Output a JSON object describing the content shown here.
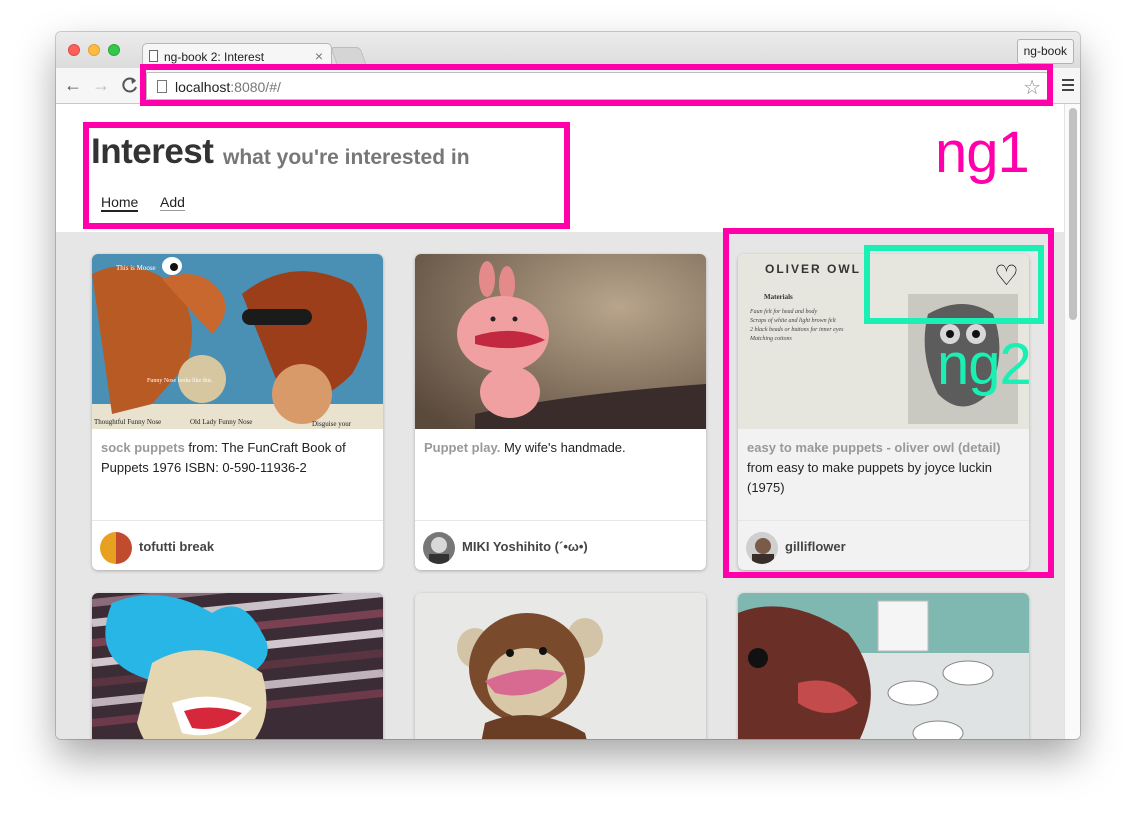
{
  "browser": {
    "tab_title": "ng-book 2: Interest",
    "tab_close": "×",
    "profile_label": "ng-book",
    "url_host": "localhost",
    "url_rest": ":8080/#/",
    "back_glyph": "←",
    "forward_glyph": "→",
    "reload_glyph": "C",
    "star_glyph": "☆"
  },
  "app": {
    "title": "Interest",
    "subtitle": "what you're interested in",
    "nav": [
      {
        "label": "Home"
      },
      {
        "label": "Add"
      }
    ]
  },
  "cards": [
    {
      "caption_title": "sock puppets",
      "caption_text": " from: The FunCraft Book of Puppets 1976 ISBN: 0-590-11936-2",
      "author": "tofutti break"
    },
    {
      "caption_title": "Puppet play.",
      "caption_text": " My wife's handmade.",
      "author": "MIKI Yoshihito (´•ω•)"
    },
    {
      "caption_title": "easy to make puppets - oliver owl (detail)",
      "caption_text": " from easy to make puppets by joyce luckin (1975)",
      "author": "gilliflower",
      "image_heading": "OLIVER OWL",
      "image_subheading": "Materials",
      "image_text": [
        "Faun felt for head and body",
        "Scraps of white and light brown felt",
        "2 black beads or buttons for inner eyes",
        "Matching cottons"
      ],
      "heart": "♡"
    },
    {},
    {},
    {}
  ],
  "image_texts": {
    "sock_top": "This is Moose",
    "sock_mid": "Funny Nose looks like this.",
    "sock_labels": [
      "Thoughtful Funny Nose",
      "Old Lady Funny Nose",
      "Disguise your"
    ]
  },
  "annotations": {
    "ng1_label": "ng1",
    "ng2_label": "ng2",
    "pink": "#ff00aa",
    "teal": "#1af0b4"
  }
}
